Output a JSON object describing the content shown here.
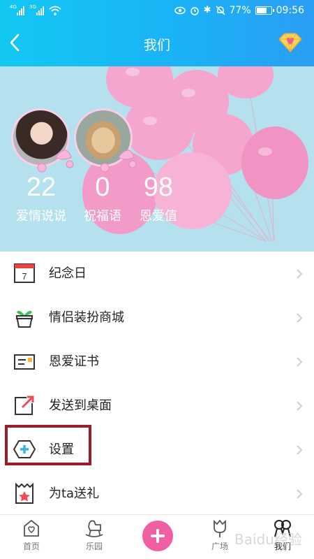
{
  "status_bar": {
    "network_1": "4G",
    "network_2": "3G",
    "battery_percent": "77%",
    "battery_level": 0.77,
    "time": "09:56"
  },
  "header": {
    "title": "我们",
    "back_icon": "chevron-left-icon",
    "vip_icon": "diamond-heart-icon"
  },
  "profile": {
    "stats": [
      {
        "value": "22",
        "label": "爱情说说"
      },
      {
        "value": "0",
        "label": "祝福语"
      },
      {
        "value": "98",
        "label": "恩爱值"
      }
    ]
  },
  "menu": {
    "items": [
      {
        "label": "纪念日",
        "icon": "calendar-icon",
        "icon_text": "7"
      },
      {
        "label": "情侣装扮商城",
        "icon": "plant-pot-icon"
      },
      {
        "label": "恩爱证书",
        "icon": "certificate-icon"
      },
      {
        "label": "发送到桌面",
        "icon": "send-to-desktop-icon"
      },
      {
        "label": "设置",
        "icon": "settings-hexagon-icon"
      },
      {
        "label": "为ta送礼",
        "icon": "gift-bag-icon"
      }
    ]
  },
  "tabbar": {
    "tabs": [
      {
        "label": "首页",
        "icon": "home-heart-icon"
      },
      {
        "label": "乐园",
        "icon": "rocking-horse-icon"
      },
      {
        "label": "",
        "icon": "plus-icon"
      },
      {
        "label": "广场",
        "icon": "tulip-icon"
      },
      {
        "label": "我们",
        "icon": "couple-icon",
        "active": true
      }
    ]
  },
  "watermark": "Baidu经验",
  "colors": {
    "header_start": "#13c8f3",
    "header_end": "#2a9ef3",
    "hero_bg": "#b4e1ed",
    "balloon": "#f4a6cf",
    "accent_pink": "#f05fa2",
    "highlight_box": "#9b1c2a"
  }
}
